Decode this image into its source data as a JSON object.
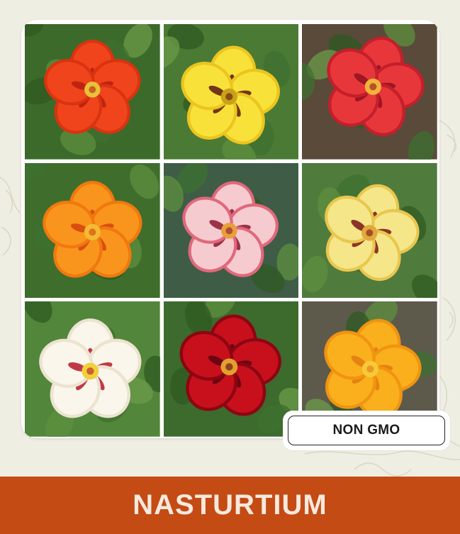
{
  "badge": {
    "label": "NON GMO"
  },
  "banner": {
    "title": "NASTURTIUM"
  },
  "colors": {
    "background": "#efeee3",
    "banner": "#c44b14",
    "banner_text": "#f7e9de",
    "badge_border": "#222222"
  },
  "photos": [
    {
      "name": "orange-nasturtium",
      "bg": "#3c6a2a",
      "petal": "#f0451c",
      "petal_edge": "#d93310",
      "mark": "#b51f0e",
      "center": "#e7c23a"
    },
    {
      "name": "yellow-nasturtium-dark-blotch",
      "bg": "#4b7a35",
      "petal": "#f8e23a",
      "petal_edge": "#ecc51f",
      "mark": "#5a1712",
      "center": "#c9a11a"
    },
    {
      "name": "red-streaked-nasturtium",
      "bg": "#5a4a3a",
      "petal": "#e8373a",
      "petal_edge": "#c51f2c",
      "mark": "#8e1020",
      "center": "#f1b33a"
    },
    {
      "name": "tangerine-nasturtium",
      "bg": "#3f6d2c",
      "petal": "#f9951c",
      "petal_edge": "#f0790f",
      "mark": "#d3420f",
      "center": "#f3bb33"
    },
    {
      "name": "pink-cream-nasturtium",
      "bg": "#3f5c47",
      "petal": "#f6cbcf",
      "petal_edge": "#e1687c",
      "mark": "#8a1830",
      "center": "#e7a03b"
    },
    {
      "name": "butter-yellow-nasturtium",
      "bg": "#4f7b3d",
      "petal": "#f5e68a",
      "petal_edge": "#e9c74e",
      "mark": "#7a1418",
      "center": "#e1a83c"
    },
    {
      "name": "cream-white-nasturtium",
      "bg": "#52863a",
      "petal": "#fbf6ec",
      "petal_edge": "#ece3d0",
      "mark": "#b5172c",
      "center": "#f0d03b"
    },
    {
      "name": "crimson-nasturtium",
      "bg": "#3c6b2d",
      "petal": "#c8101c",
      "petal_edge": "#8c0612",
      "mark": "#5a0410",
      "center": "#e1a12f"
    },
    {
      "name": "golden-nasturtium",
      "bg": "#5d5a4c",
      "petal": "#f9b01c",
      "petal_edge": "#f19411",
      "mark": "#e07a10",
      "center": "#f7c93a"
    }
  ]
}
